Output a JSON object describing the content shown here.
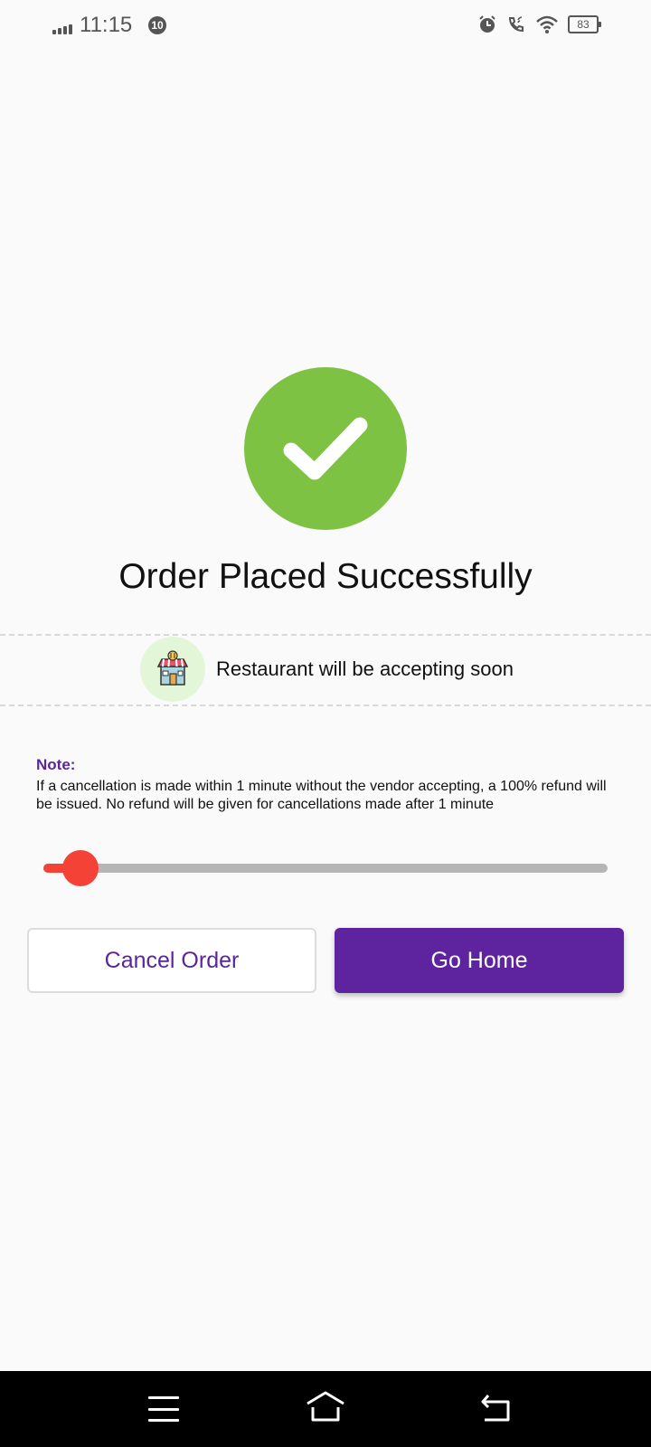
{
  "status_bar": {
    "time": "11:15",
    "notification_count": "10",
    "battery_level": "83"
  },
  "success": {
    "title": "Order Placed Successfully",
    "icon": "check-icon",
    "color": "#7dc243"
  },
  "restaurant": {
    "icon": "restaurant-icon",
    "status_text": "Restaurant will be accepting soon"
  },
  "note": {
    "title": "Note:",
    "text": "If a cancellation is made within 1 minute without the vendor accepting, a 100% refund will be issued. No refund will be given for cancellations made after 1 minute"
  },
  "timer_slider": {
    "progress": 0.065,
    "color": "#f44336"
  },
  "buttons": {
    "cancel_label": "Cancel Order",
    "home_label": "Go Home"
  },
  "colors": {
    "accent": "#5e24a0",
    "success": "#7dc243",
    "danger": "#f44336"
  },
  "nav_bar": {
    "icons": [
      "menu-icon",
      "home-icon",
      "back-icon"
    ]
  }
}
